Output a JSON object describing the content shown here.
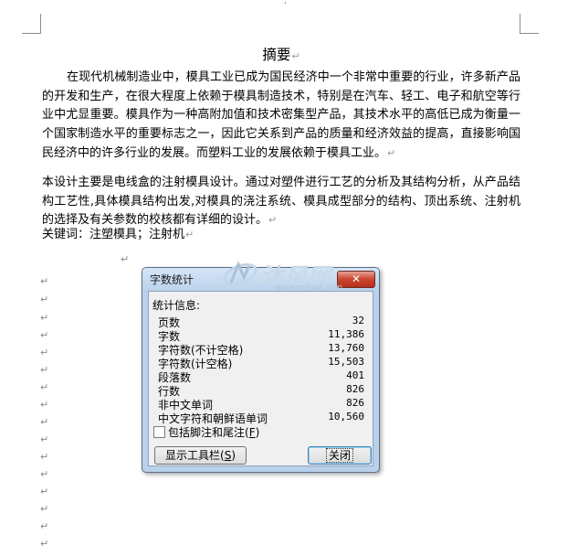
{
  "document": {
    "title": "摘要",
    "paragraph_mark": "↵",
    "p1": "在现代机械制造业中，模具工业已成为国民经济中一个非常中重要的行业，许多新产品的开发和生产，在很大程度上依赖于模具制造技术，特别是在汽车、轻工、电子和航空等行业中尤显重要。模具作为一种高附加值和技术密集型产品，其技术水平的高低已成为衡量一个国家制造水平的重要标志之一，因此它关系到产品的质量和经济效益的提高，直接影响国民经济中的许多行业的发展。而塑料工业的发展依赖于模具工业。",
    "p2": "本设计主要是电线盒的注射模具设计。通过对塑件进行工艺的分析及其结构分析，从产品结构工艺性,具体模具结构出发,对模具的浇注系统、模具成型部分的结构、顶出系统、注射机的选择及有关参数的校核都有详细的设计。",
    "p3": "关键词：注塑模具；注射机"
  },
  "watermark": {
    "text": "沐风网",
    "url": "www.mfcad.com"
  },
  "dialog": {
    "title": "字数统计",
    "close_glyph": "✕",
    "info_label": "统计信息:",
    "stats": [
      {
        "label": "页数",
        "value": "32"
      },
      {
        "label": "字数",
        "value": "11,386"
      },
      {
        "label": "字符数(不计空格)",
        "value": "13,760"
      },
      {
        "label": "字符数(计空格)",
        "value": "15,503"
      },
      {
        "label": "段落数",
        "value": "401"
      },
      {
        "label": "行数",
        "value": "826"
      },
      {
        "label": "非中文单词",
        "value": "826"
      },
      {
        "label": "中文字符和朝鲜语单词",
        "value": "10,560"
      }
    ],
    "checkbox": {
      "label": "包括脚注和尾注",
      "hotkey": "F",
      "checked": false
    },
    "toolbar_button": {
      "label": "显示工具栏",
      "hotkey": "S"
    },
    "close_button": {
      "label": "关闭"
    }
  }
}
